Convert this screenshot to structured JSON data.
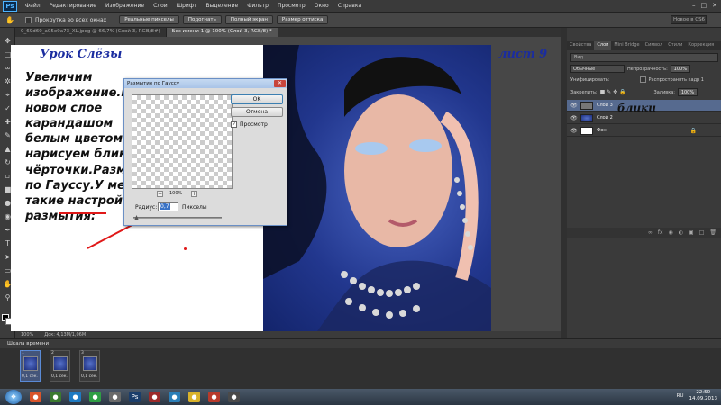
{
  "app": {
    "logo": "Ps"
  },
  "menu": [
    "Файл",
    "Редактирование",
    "Изображение",
    "Слои",
    "Шрифт",
    "Выделение",
    "Фильтр",
    "Просмотр",
    "Окно",
    "Справка"
  ],
  "options_bar": {
    "scroll_all_label": "Прокрутка во всех окнах",
    "actual_pixels": "Реальные пикселы",
    "fit_screen": "Подогнать",
    "full_screen": "Полный экран",
    "print_size": "Размер оттиска",
    "workspace": "Новое в CS6"
  },
  "doc_tabs": [
    {
      "label": "0_69d60_a05e9a73_XL.jpeg @ 66,7% (Слой 3, RGB/8#)",
      "active": false
    },
    {
      "label": "Без имени-1 @ 100% (Слой 3, RGB/8) *",
      "active": true
    }
  ],
  "document": {
    "lesson_title": "Урок Слёзы",
    "sheet_label": "лист 9",
    "instruction": "Увеличим изображение.На новом слое карандашом белым цветом нарисуем блики-чёрточки.Размоем по Гауссу.У меня такие настройки размытия:",
    "layers_tag": "блики"
  },
  "gauss_dialog": {
    "title": "Размытие по Гауссу",
    "ok_label": "OK",
    "cancel_label": "Отмена",
    "preview_label": "Просмотр",
    "preview_checked": true,
    "zoom_value": "100%",
    "radius_label": "Радиус:",
    "radius_value": "0,7",
    "radius_unit": "Пикселы"
  },
  "panels": {
    "tabs": [
      "Свойства",
      "Слои",
      "Mini Bridge",
      "Символ",
      "Стили",
      "Коррекция"
    ],
    "active_tab": "Слои",
    "filter_label": "Вид",
    "blend_mode": "Обычные",
    "opacity_label": "Непрозрачность:",
    "opacity_value": "100%",
    "unify_label": "Унифицировать:",
    "propagate_label": "Распространять кадр 1",
    "lock_label": "Закрепить:",
    "fill_label": "Заливка:",
    "fill_value": "100%",
    "layers": [
      {
        "name": "Слой 3",
        "selected": true
      },
      {
        "name": "Слой 2",
        "selected": false
      },
      {
        "name": "Фон",
        "selected": false
      }
    ]
  },
  "status": {
    "zoom": "100%",
    "doc": "Док: 4,13M/1,06M"
  },
  "timeline": {
    "title": "Шкала времени",
    "frames": [
      {
        "num": "1",
        "delay": "0,1 сек."
      },
      {
        "num": "2",
        "delay": "0,1 сек."
      },
      {
        "num": "3",
        "delay": "0,1 сек."
      }
    ]
  },
  "taskbar": {
    "lang": "RU",
    "time": "22:50",
    "date": "14.09.2013"
  }
}
